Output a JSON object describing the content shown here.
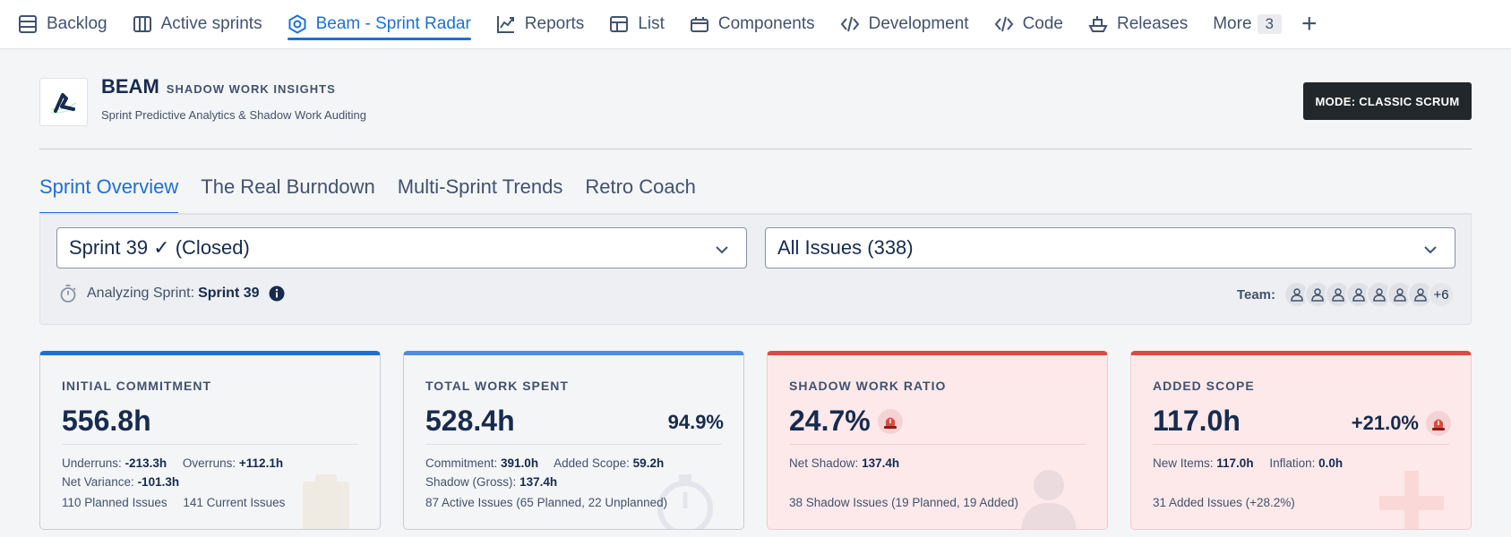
{
  "nav": {
    "items": [
      {
        "label": "Backlog",
        "icon": "backlog-icon"
      },
      {
        "label": "Active sprints",
        "icon": "board-icon"
      },
      {
        "label": "Beam - Sprint Radar",
        "icon": "hexagon-icon",
        "active": true
      },
      {
        "label": "Reports",
        "icon": "chart-line-icon"
      },
      {
        "label": "List",
        "icon": "table-icon"
      },
      {
        "label": "Components",
        "icon": "components-icon"
      },
      {
        "label": "Development",
        "icon": "development-icon"
      },
      {
        "label": "Code",
        "icon": "code-icon"
      },
      {
        "label": "Releases",
        "icon": "ship-icon"
      }
    ],
    "more_label": "More",
    "more_count": "3",
    "add_label": "+"
  },
  "header": {
    "brand_name": "BEAM",
    "brand_subtitle": "SHADOW WORK INSIGHTS",
    "tagline": "Sprint Predictive Analytics & Shadow Work Auditing",
    "mode_button": "MODE: CLASSIC SCRUM"
  },
  "tabs": [
    "Sprint Overview",
    "The Real Burndown",
    "Multi-Sprint Trends",
    "Retro Coach"
  ],
  "filters": {
    "sprint_select": "Sprint 39 ✓ (Closed)",
    "issue_select": "All Issues (338)",
    "analyzing_label": "Analyzing Sprint:",
    "analyzing_value": "Sprint 39",
    "team_label": "Team:",
    "team_more": "+6"
  },
  "cards": {
    "commitment": {
      "label": "INITIAL COMMITMENT",
      "value": "556.8h",
      "underruns_label": "Underruns:",
      "underruns_value": "-213.3h",
      "overruns_label": "Overruns:",
      "overruns_value": "+112.1h",
      "variance_label": "Net Variance:",
      "variance_value": "-101.3h",
      "footer": "110 Planned Issues",
      "footer2": "141 Current Issues"
    },
    "spent": {
      "label": "TOTAL WORK SPENT",
      "value": "528.4h",
      "side": "94.9%",
      "commitment_label": "Commitment:",
      "commitment_value": "391.0h",
      "added_label": "Added Scope:",
      "added_value": "59.2h",
      "shadow_label": "Shadow (Gross):",
      "shadow_value": "137.4h",
      "footer": "87 Active Issues (65 Planned, 22 Unplanned)"
    },
    "shadow": {
      "label": "SHADOW WORK RATIO",
      "value": "24.7%",
      "net_label": "Net Shadow:",
      "net_value": "137.4h",
      "footer": "38 Shadow Issues (19 Planned, 19 Added)"
    },
    "scope": {
      "label": "ADDED SCOPE",
      "value": "117.0h",
      "side": "+21.0%",
      "new_label": "New Items:",
      "new_value": "117.0h",
      "inflation_label": "Inflation:",
      "inflation_value": "0.0h",
      "footer": "31 Added Issues (+28.2%)"
    }
  },
  "colors": {
    "accent": "#1f6fd1",
    "alert": "#de4a41",
    "alert_bg": "#fde9ea"
  }
}
